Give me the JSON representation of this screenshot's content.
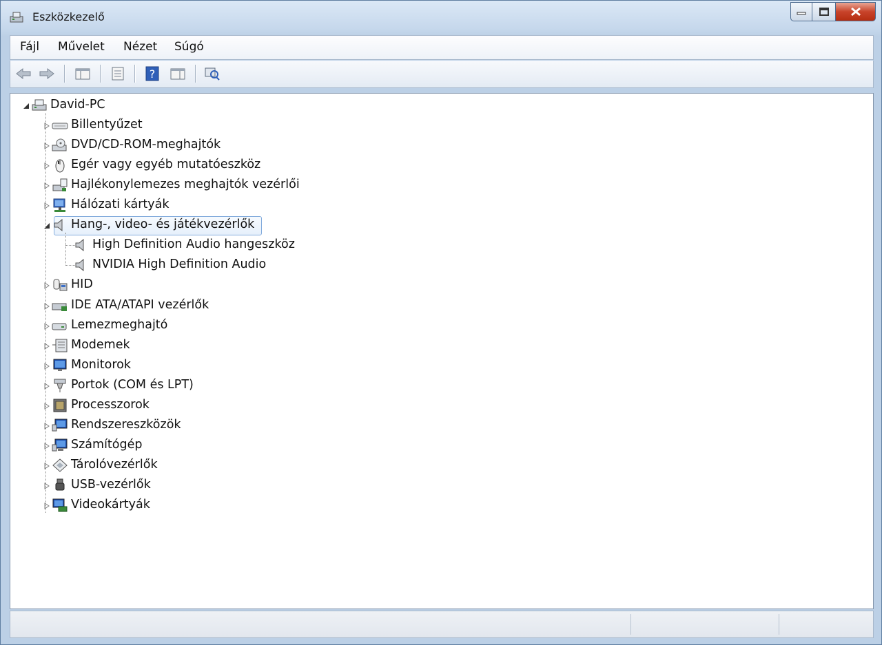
{
  "window": {
    "title": "Eszközkezelő"
  },
  "menu": [
    "Fájl",
    "Művelet",
    "Nézet",
    "Súgó"
  ],
  "toolbar": {
    "buttons": [
      "back-icon",
      "forward-icon",
      "show-hide-console-tree-icon",
      "properties-icon",
      "help-icon",
      "action-pane-icon",
      "scan-hardware-icon"
    ]
  },
  "tree": {
    "root": "David-PC",
    "categories": [
      {
        "label": "Billentyűzet",
        "icon": "keyboard-icon"
      },
      {
        "label": "DVD/CD-ROM-meghajtók",
        "icon": "dvd-drive-icon"
      },
      {
        "label": "Egér vagy egyéb mutatóeszköz",
        "icon": "mouse-icon"
      },
      {
        "label": "Hajlékonylemezes meghajtók vezérlői",
        "icon": "floppy-controller-icon"
      },
      {
        "label": "Hálózati kártyák",
        "icon": "network-adapter-icon"
      },
      {
        "label": "Hang-, video- és játékvezérlők",
        "icon": "speaker-icon",
        "expanded": true,
        "selected": true,
        "children": [
          "High Definition Audio hangeszköz",
          "NVIDIA High Definition Audio"
        ]
      },
      {
        "label": "HID",
        "icon": "hid-icon"
      },
      {
        "label": "IDE ATA/ATAPI vezérlők",
        "icon": "ide-controller-icon"
      },
      {
        "label": "Lemezmeghajtó",
        "icon": "disk-drive-icon"
      },
      {
        "label": "Modemek",
        "icon": "modem-icon"
      },
      {
        "label": "Monitorok",
        "icon": "monitor-icon"
      },
      {
        "label": "Portok (COM és LPT)",
        "icon": "port-icon"
      },
      {
        "label": "Processzorok",
        "icon": "processor-icon"
      },
      {
        "label": "Rendszereszközök",
        "icon": "system-devices-icon"
      },
      {
        "label": "Számítógép",
        "icon": "computer-icon"
      },
      {
        "label": "Tárolóvezérlők",
        "icon": "storage-controller-icon"
      },
      {
        "label": "USB-vezérlők",
        "icon": "usb-icon"
      },
      {
        "label": "Videokártyák",
        "icon": "display-adapter-icon"
      }
    ]
  },
  "colors": {
    "selection_border": "#84acdd",
    "close_button": "#c8432a"
  }
}
